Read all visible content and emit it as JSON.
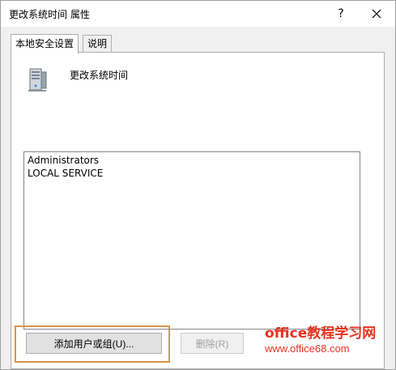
{
  "window": {
    "title": "更改系统时间 属性",
    "help_label": "?",
    "close_icon": "close-icon"
  },
  "tabs": [
    {
      "label": "本地安全设置",
      "active": true
    },
    {
      "label": "说明",
      "active": false
    }
  ],
  "policy": {
    "icon": "server-computer-icon",
    "name": "更改系统时间"
  },
  "user_list": {
    "items": [
      "Administrators",
      "LOCAL SERVICE"
    ]
  },
  "buttons": {
    "add_label": "添加用户或组(U)...",
    "remove_label": "删除(R)",
    "remove_enabled": false
  },
  "highlight": {
    "color": "#d8944a"
  },
  "watermark": {
    "line1": "office教程学习网",
    "line2": "www.office68.com",
    "color": "#e8321e"
  }
}
